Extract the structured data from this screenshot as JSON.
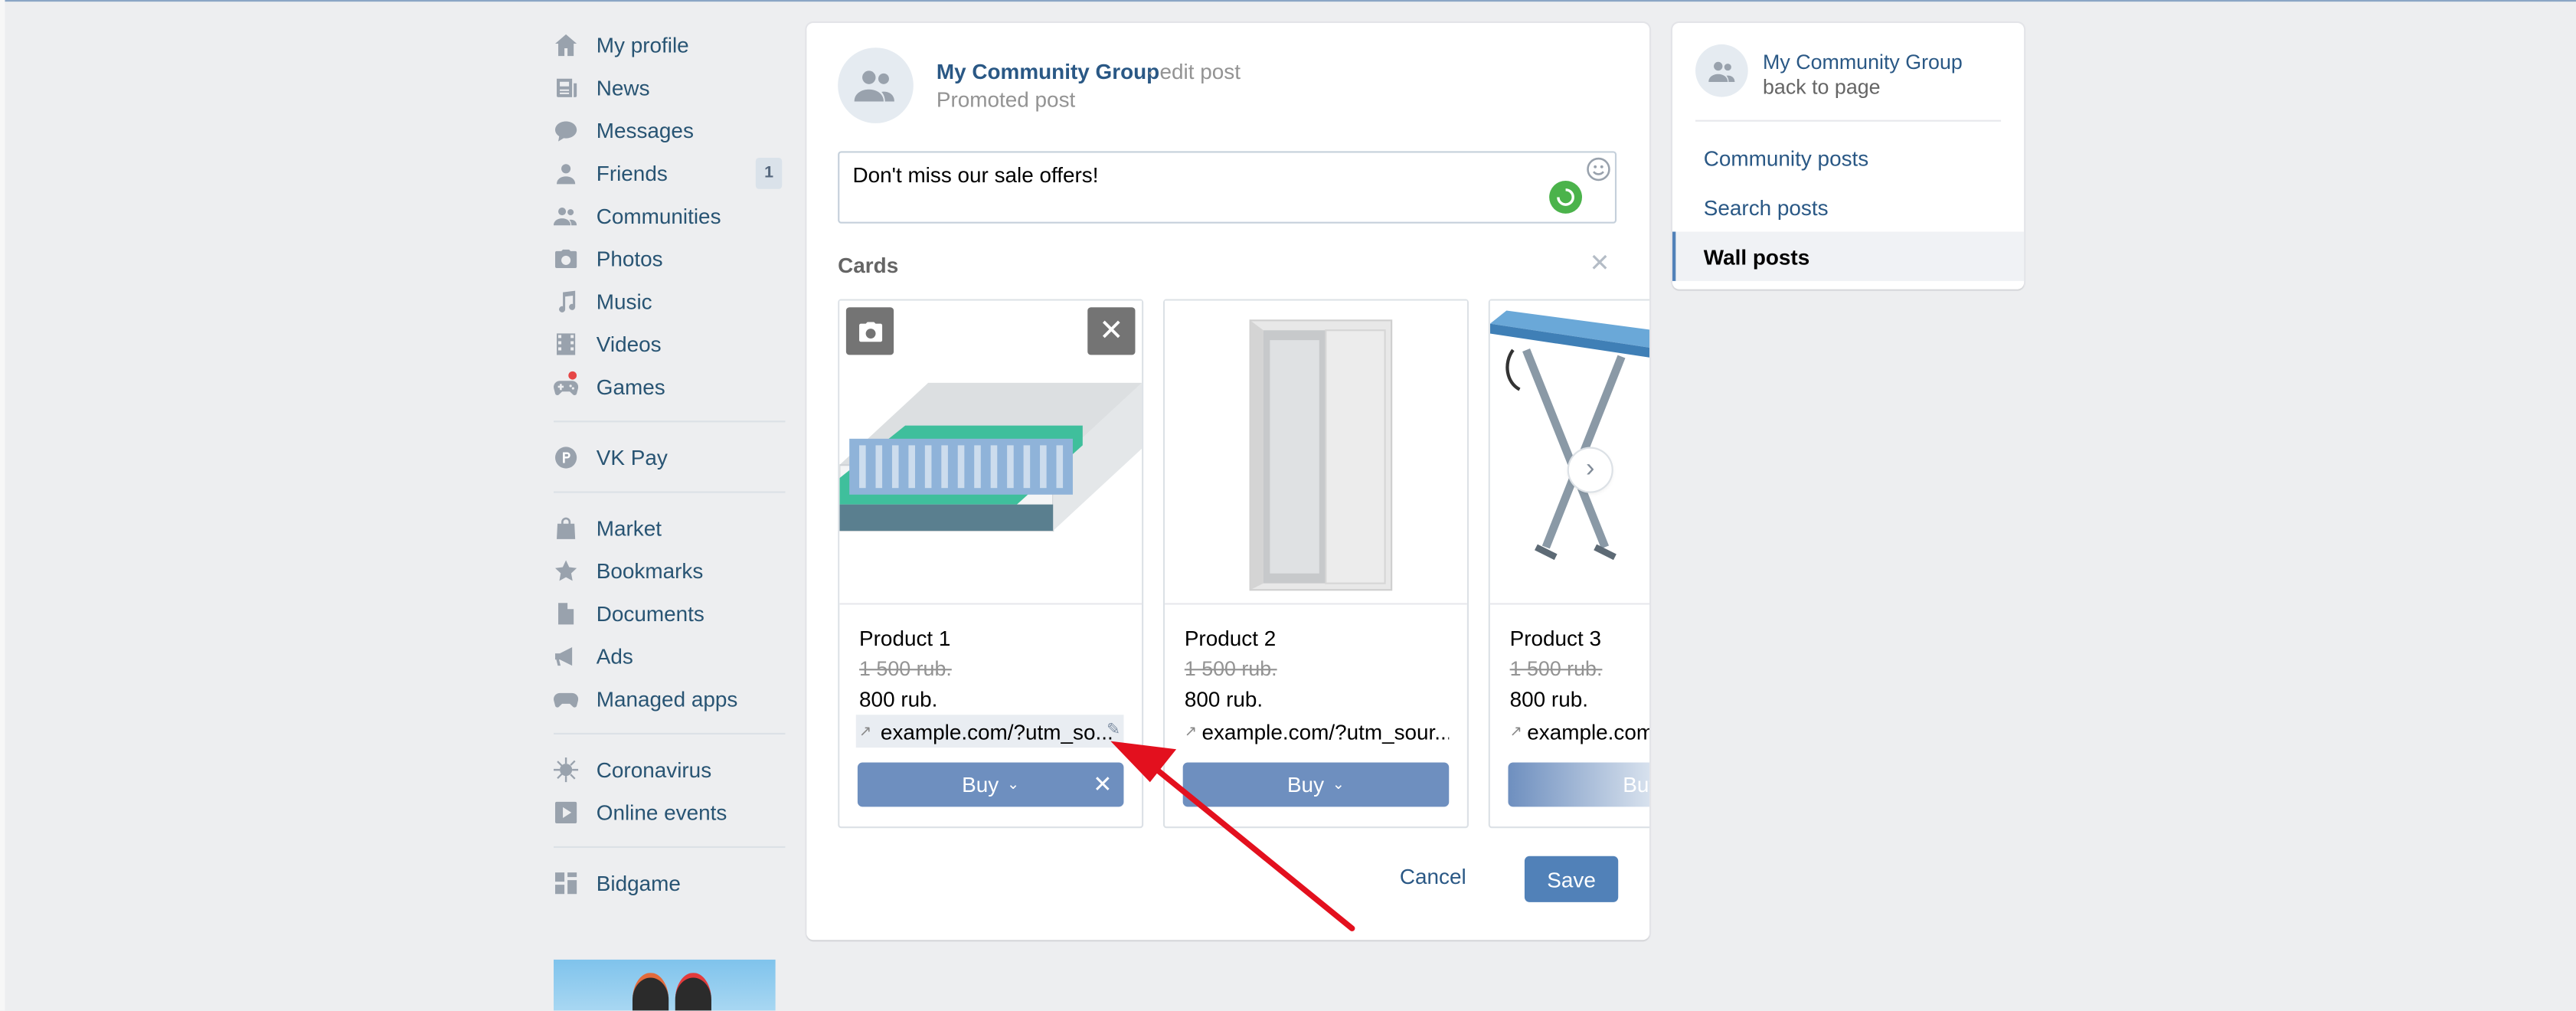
{
  "nav": {
    "items": [
      {
        "label": "My profile",
        "icon": "home-icon"
      },
      {
        "label": "News",
        "icon": "news-icon"
      },
      {
        "label": "Messages",
        "icon": "messages-icon"
      },
      {
        "label": "Friends",
        "icon": "friends-icon",
        "counter": "1"
      },
      {
        "label": "Communities",
        "icon": "communities-icon"
      },
      {
        "label": "Photos",
        "icon": "camera-icon"
      },
      {
        "label": "Music",
        "icon": "music-icon"
      },
      {
        "label": "Videos",
        "icon": "film-icon"
      },
      {
        "label": "Games",
        "icon": "gamepad-icon"
      },
      {
        "label": "VK Pay",
        "icon": "vkpay-icon"
      },
      {
        "label": "Market",
        "icon": "bag-icon"
      },
      {
        "label": "Bookmarks",
        "icon": "star-icon"
      },
      {
        "label": "Documents",
        "icon": "document-icon"
      },
      {
        "label": "Ads",
        "icon": "megaphone-icon"
      },
      {
        "label": "Managed apps",
        "icon": "gamepad-icon"
      },
      {
        "label": "Coronavirus",
        "icon": "virus-icon"
      },
      {
        "label": "Online events",
        "icon": "play-icon"
      },
      {
        "label": "Bidgame",
        "icon": "grid-icon"
      }
    ]
  },
  "post": {
    "group_name": "My Community Group",
    "edit_label": "· edit post",
    "subtitle": "Promoted post",
    "text": "Don't miss our sale offers!",
    "cards_title": "Cards"
  },
  "cards": [
    {
      "name": "Product 1",
      "old_price": "1 500 rub.",
      "price": "800 rub.",
      "link": "example.com/?utm_so...",
      "button": "Buy"
    },
    {
      "name": "Product 2",
      "old_price": "1 500 rub.",
      "price": "800 rub.",
      "link": "example.com/?utm_sour...",
      "button": "Buy"
    },
    {
      "name": "Product 3",
      "old_price": "1 500 rub.",
      "price": "800 rub.",
      "link": "example.com/?utm_sour...",
      "button": "Buy"
    }
  ],
  "actions": {
    "cancel": "Cancel",
    "save": "Save"
  },
  "right_panel": {
    "group_name": "My Community Group",
    "back": "back to page",
    "items": [
      "Community posts",
      "Search posts",
      "Wall posts"
    ],
    "active": "Wall posts"
  },
  "colors": {
    "accent": "#5181b8",
    "link": "#2a5885",
    "button": "#6e8fbf",
    "background": "#edeef0",
    "arrow": "#e3101e"
  }
}
